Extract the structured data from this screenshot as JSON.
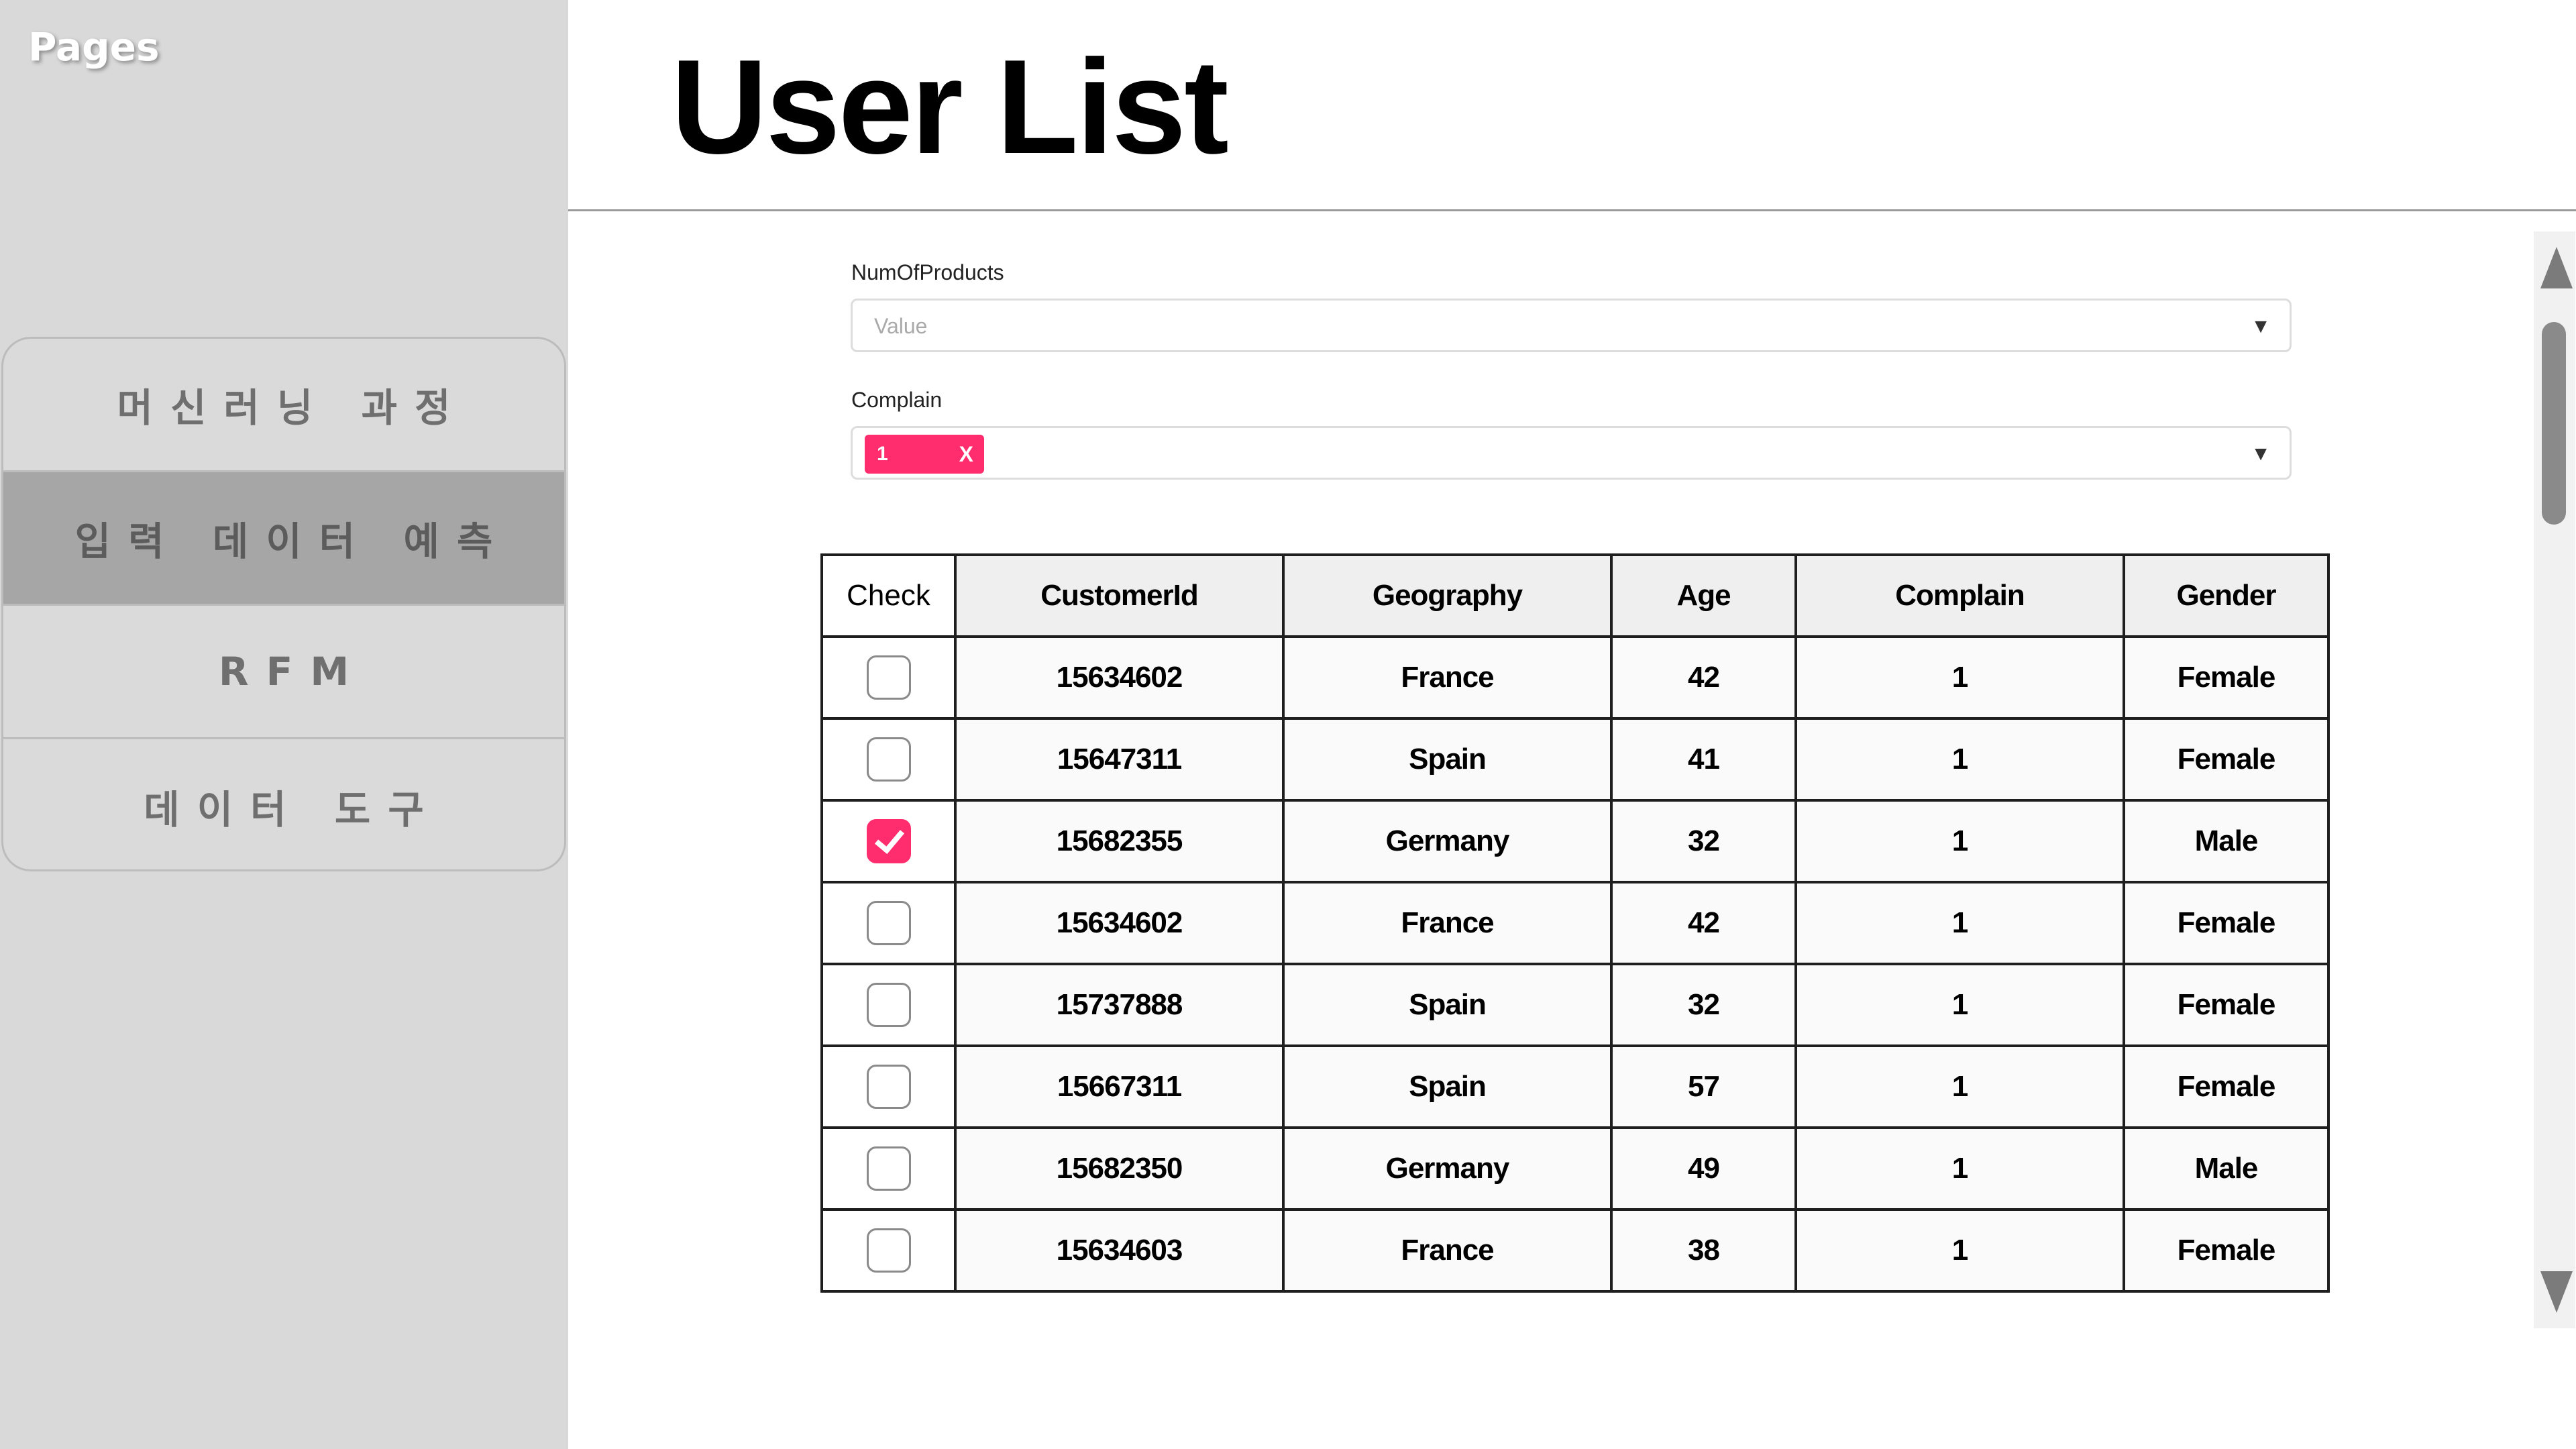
{
  "sidebar": {
    "title": "Pages",
    "items": [
      {
        "label": "머신러닝 과정",
        "active": false
      },
      {
        "label": "입력 데이터 예측",
        "active": true
      },
      {
        "label": "RFM",
        "active": false
      },
      {
        "label": "데이터 도구",
        "active": false
      }
    ]
  },
  "header": {
    "title": "User List"
  },
  "filters": {
    "num_of_products": {
      "label": "NumOfProducts",
      "placeholder": "Value"
    },
    "complain": {
      "label": "Complain",
      "selected": [
        "1"
      ],
      "remove_symbol": "X"
    }
  },
  "table": {
    "columns": [
      "Check",
      "CustomerId",
      "Geography",
      "Age",
      "Complain",
      "Gender"
    ],
    "rows": [
      {
        "checked": false,
        "customer_id": "15634602",
        "geography": "France",
        "age": "42",
        "complain": "1",
        "gender": "Female"
      },
      {
        "checked": false,
        "customer_id": "15647311",
        "geography": "Spain",
        "age": "41",
        "complain": "1",
        "gender": "Female"
      },
      {
        "checked": true,
        "customer_id": "15682355",
        "geography": "Germany",
        "age": "32",
        "complain": "1",
        "gender": "Male"
      },
      {
        "checked": false,
        "customer_id": "15634602",
        "geography": "France",
        "age": "42",
        "complain": "1",
        "gender": "Female"
      },
      {
        "checked": false,
        "customer_id": "15737888",
        "geography": "Spain",
        "age": "32",
        "complain": "1",
        "gender": "Female"
      },
      {
        "checked": false,
        "customer_id": "15667311",
        "geography": "Spain",
        "age": "57",
        "complain": "1",
        "gender": "Female"
      },
      {
        "checked": false,
        "customer_id": "15682350",
        "geography": "Germany",
        "age": "49",
        "complain": "1",
        "gender": "Male"
      },
      {
        "checked": false,
        "customer_id": "15634603",
        "geography": "France",
        "age": "38",
        "complain": "1",
        "gender": "Female"
      }
    ]
  },
  "colors": {
    "accent": "#ff2d6e",
    "sidebar_bg": "#d9d9d9",
    "sidebar_active": "#a6a6a6"
  },
  "icons": {
    "dropdown": "chevron-down-icon",
    "scroll_up": "scroll-up-icon",
    "scroll_down": "scroll-down-icon"
  }
}
